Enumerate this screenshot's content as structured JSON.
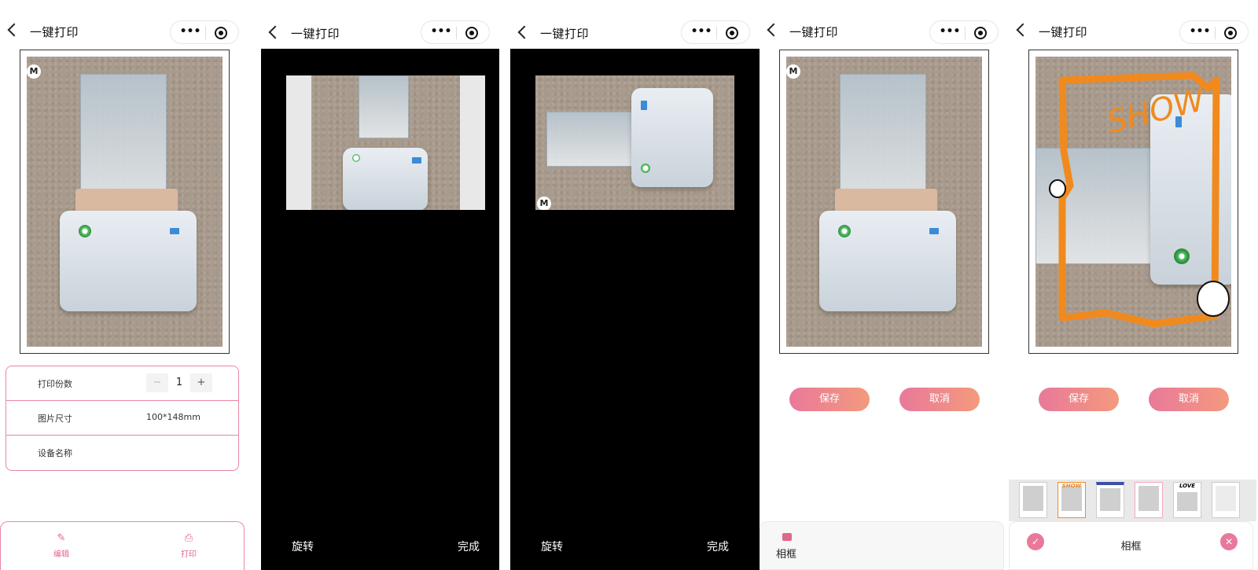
{
  "header": {
    "title": "一键打印"
  },
  "print_settings": {
    "copies_label": "打印份数",
    "copies_value": "1",
    "minus": "−",
    "plus": "+",
    "size_label": "图片尺寸",
    "size_value": "100*148mm",
    "device_label": "设备名称",
    "device_value": ""
  },
  "bottom_toolbar": {
    "edit_label": "编辑",
    "print_label": "打印"
  },
  "crop_view": {
    "rotate_label": "旋转",
    "done_label": "完成"
  },
  "edit_actions": {
    "save_label": "保存",
    "cancel_label": "取消"
  },
  "frame_tool": {
    "label": "相框"
  },
  "frame_thumbs": [
    {
      "text": ""
    },
    {
      "text": "SHOW"
    },
    {
      "text": ""
    },
    {
      "text": ""
    },
    {
      "text": "LOVE"
    },
    {
      "text": ""
    }
  ],
  "photo_overlay": {
    "doodle_text": "SHOW"
  },
  "colors": {
    "accent": "#e9799a",
    "accent_end": "#f39a7d",
    "border": "#e887a1"
  }
}
